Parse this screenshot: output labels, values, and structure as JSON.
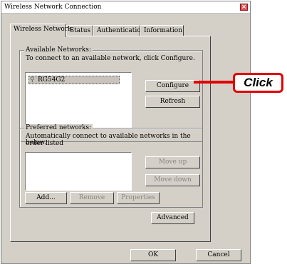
{
  "window": {
    "title": "Wireless Network Connection",
    "close": "×"
  },
  "tabs": [
    {
      "label": "Wireless Network"
    },
    {
      "label": "Status"
    },
    {
      "label": "Authentication"
    },
    {
      "label": "Information"
    }
  ],
  "available": {
    "title": "Available Networks:",
    "description": "To connect to an available network, click Configure.",
    "networks": [
      {
        "name": "RG54G2",
        "icon": "antenna-icon"
      }
    ],
    "configure_label": "Configure",
    "refresh_label": "Refresh"
  },
  "preferred": {
    "title": "Preferred networks:",
    "description_line1": "Automatically connect to available networks in the order listed",
    "description_line2": "below.",
    "move_up_label": "Move up",
    "move_down_label": "Move down",
    "add_label": "Add...",
    "remove_label": "Remove",
    "properties_label": "Properties"
  },
  "advanced_label": "Advanced",
  "ok_label": "OK",
  "cancel_label": "Cancel",
  "callout": {
    "text": "Click",
    "color": "#e00000"
  }
}
